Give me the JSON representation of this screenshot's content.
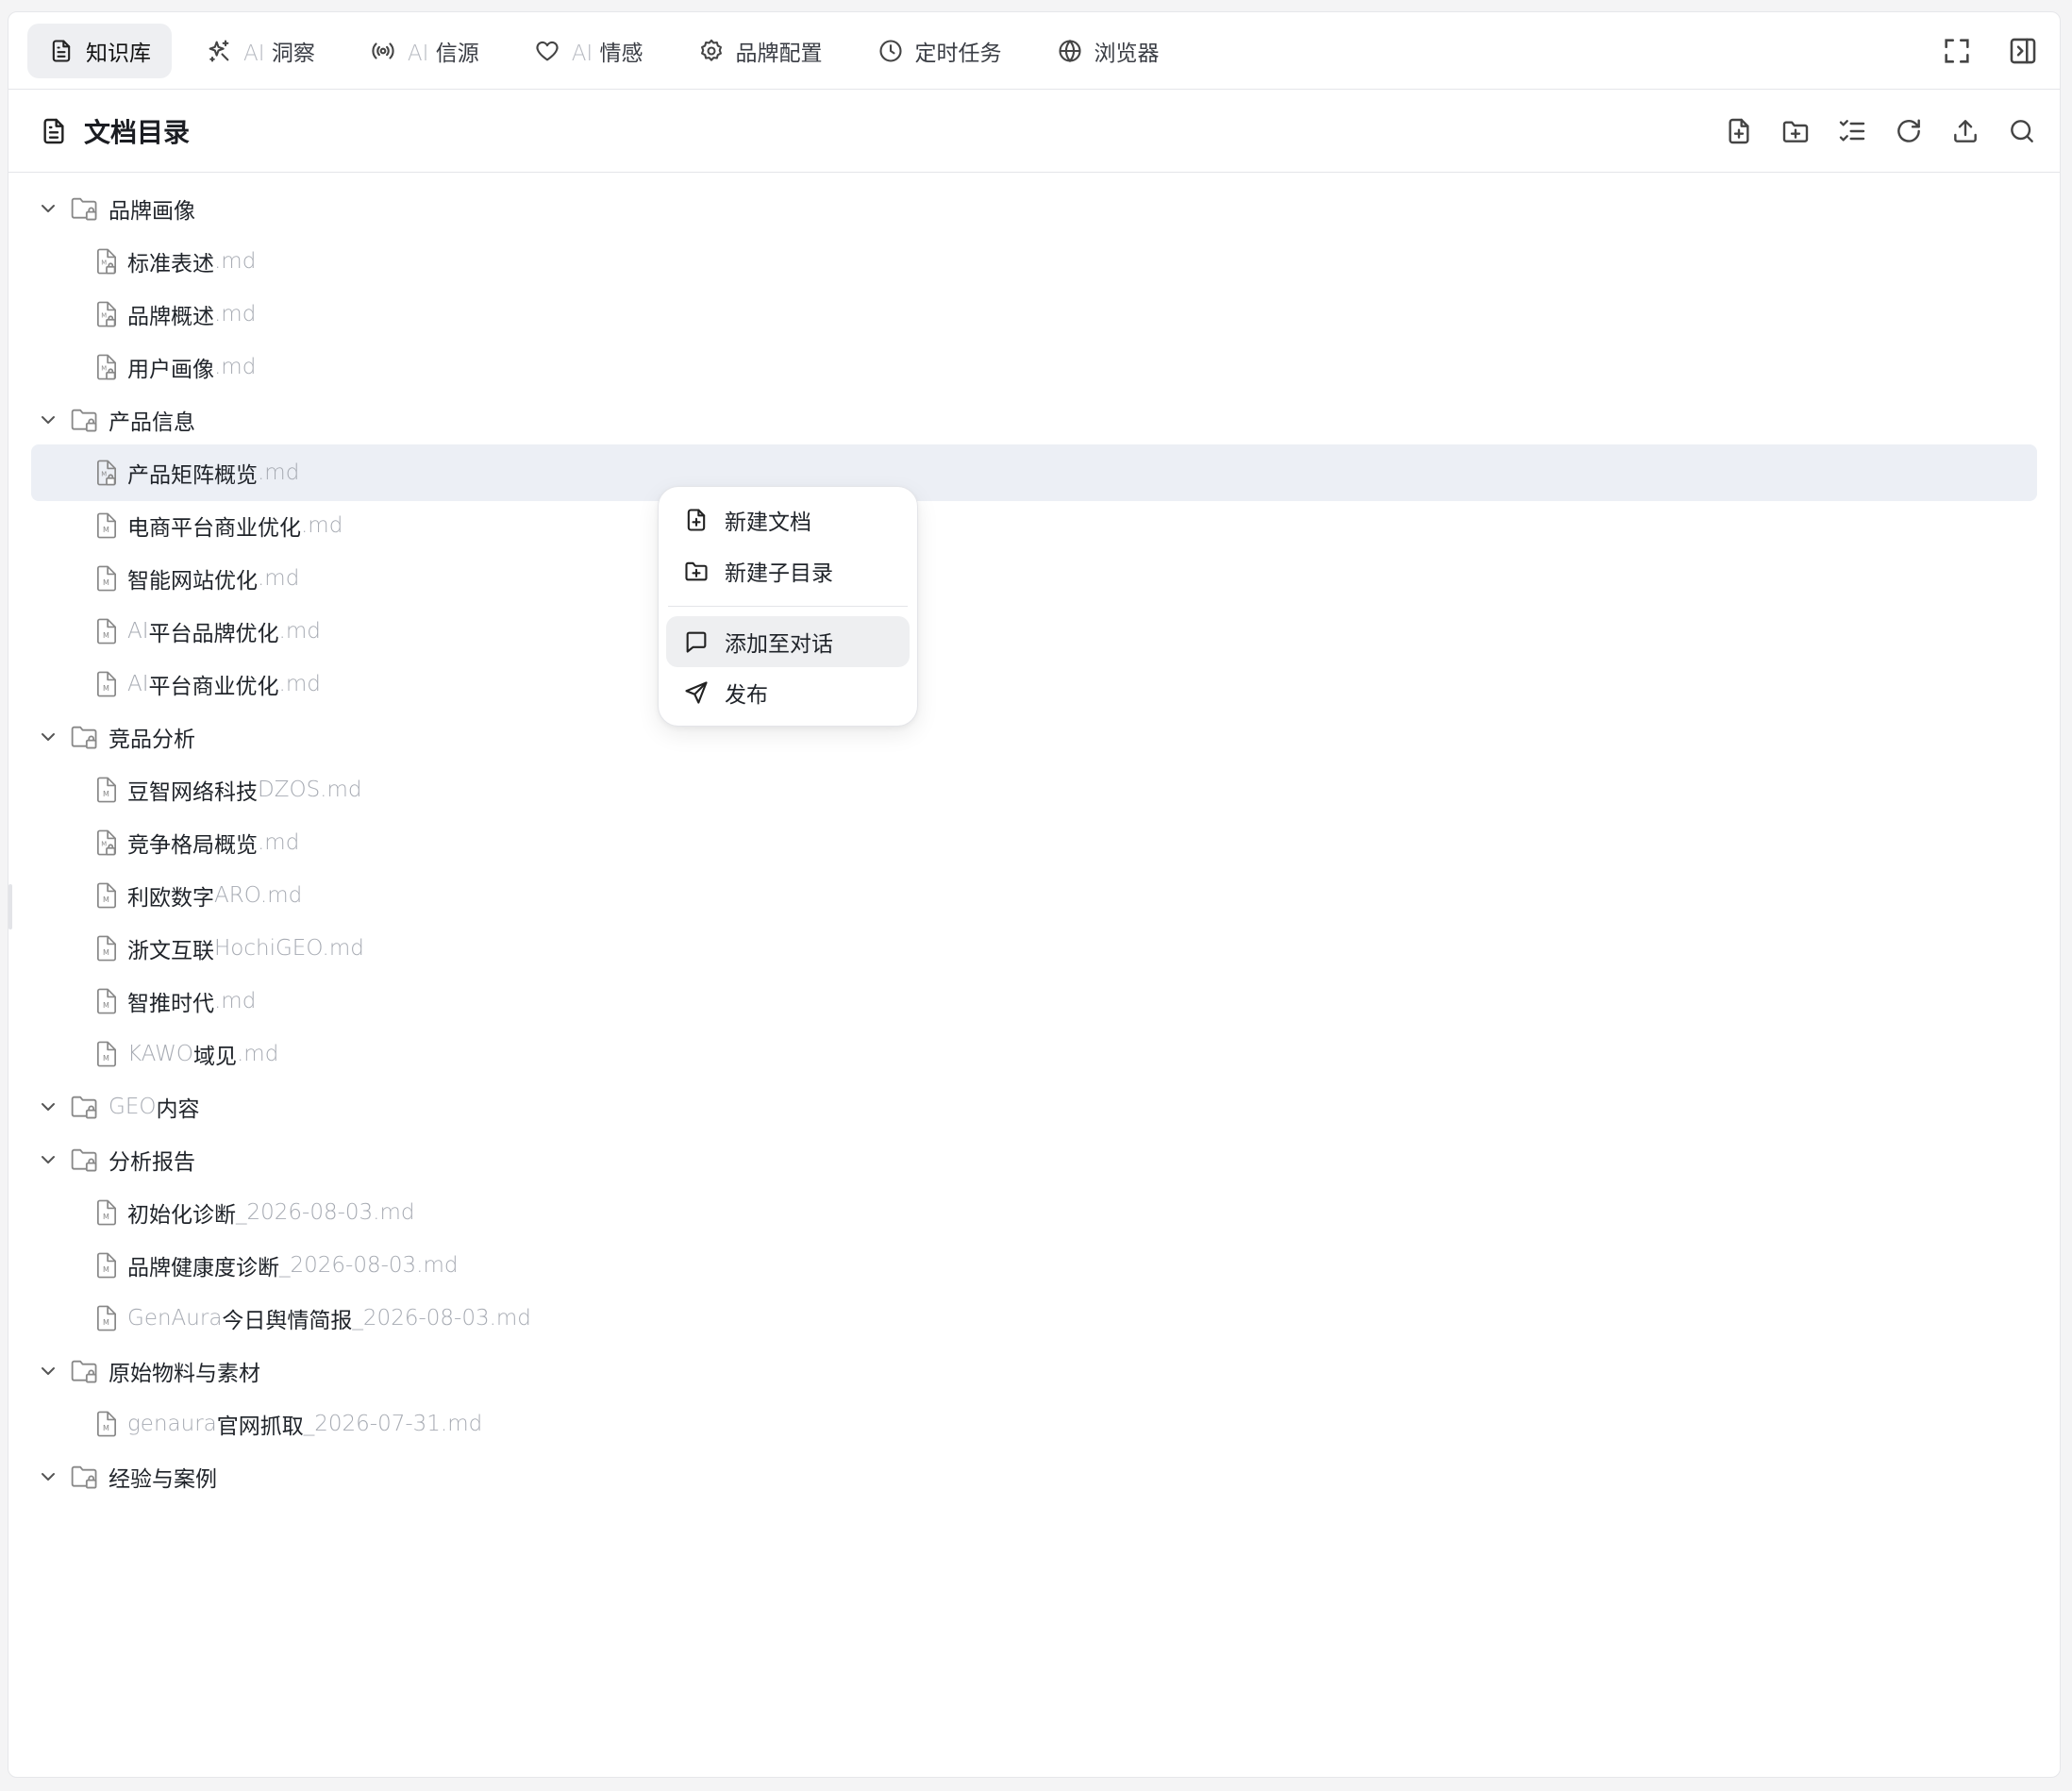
{
  "tabs": [
    {
      "ai_prefix": "",
      "label": "知识库"
    },
    {
      "ai_prefix": "AI",
      "label": "洞察"
    },
    {
      "ai_prefix": "AI",
      "label": "信源"
    },
    {
      "ai_prefix": "AI",
      "label": "情感"
    },
    {
      "ai_prefix": "",
      "label": "品牌配置"
    },
    {
      "ai_prefix": "",
      "label": "定时任务"
    },
    {
      "ai_prefix": "",
      "label": "浏览器"
    }
  ],
  "header": {
    "title": "文档目录"
  },
  "tree": {
    "folders": [
      {
        "name": "品牌画像",
        "files": [
          {
            "name": "标准表述",
            "ext": ".md"
          },
          {
            "name": "品牌概述",
            "ext": ".md"
          },
          {
            "name": "用户画像",
            "ext": ".md"
          }
        ]
      },
      {
        "name": "产品信息",
        "files": [
          {
            "name": "产品矩阵概览",
            "ext": ".md"
          },
          {
            "name": "电商平台商业优化",
            "ext": ".md"
          },
          {
            "name": "智能网站优化",
            "ext": ".md"
          },
          {
            "prefix": "AI",
            "name": "平台品牌优化",
            "ext": ".md"
          },
          {
            "prefix": "AI",
            "name": "平台商业优化",
            "ext": ".md"
          }
        ]
      },
      {
        "name": "竞品分析",
        "files": [
          {
            "name": "豆智网络科技",
            "ext": "DZOS.md"
          },
          {
            "name": "竞争格局概览",
            "ext": ".md"
          },
          {
            "name": "利欧数字",
            "ext": "ARO.md"
          },
          {
            "name": "浙文互联",
            "ext": "HochiGEO.md"
          },
          {
            "name": "智推时代",
            "ext": ".md"
          },
          {
            "prefix": "KAWO",
            "name": "域见",
            "ext": ".md"
          }
        ]
      },
      {
        "prefix": "GEO ",
        "name": "内容",
        "files": []
      },
      {
        "name": "分析报告",
        "files": [
          {
            "name": "初始化诊断",
            "ext": "_2026-08-03.md"
          },
          {
            "name": "品牌健康度诊断",
            "ext": "_2026-08-03.md"
          },
          {
            "prefix": "GenAura",
            "name": "今日舆情简报",
            "ext": "_2026-08-03.md"
          }
        ]
      },
      {
        "name": "原始物料与素材",
        "files": [
          {
            "prefix": "genaura",
            "name": "官网抓取",
            "ext": "_2026-07-31.md"
          }
        ]
      },
      {
        "name": "经验与案例",
        "files": []
      }
    ]
  },
  "context_menu": {
    "items": [
      "新建文档",
      "新建子目录",
      "添加至对话",
      "发布"
    ]
  },
  "colors": {
    "selected_row": "#eceff5",
    "muted_text": "#a7abb3",
    "active_tab": "#eeeff2"
  }
}
